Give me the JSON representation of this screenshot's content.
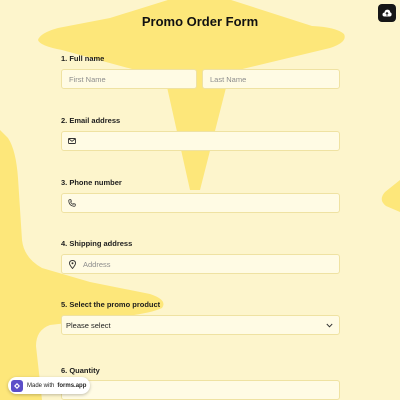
{
  "form": {
    "title": "Promo Order Form",
    "questions": [
      {
        "number_label": "1. Full name",
        "first_name_placeholder": "First Name",
        "last_name_placeholder": "Last Name"
      },
      {
        "number_label": "2. Email address",
        "icon": "envelope-icon",
        "value": ""
      },
      {
        "number_label": "3. Phone number",
        "icon": "phone-icon",
        "value": ""
      },
      {
        "number_label": "4. Shipping address",
        "icon": "location-pin-icon",
        "placeholder": "Address"
      },
      {
        "number_label": "5. Select the promo product",
        "selected": "Please select",
        "icon": "chevron-down-icon"
      },
      {
        "number_label": "6. Quantity",
        "value": ""
      }
    ]
  },
  "badge": {
    "prefix": "Made with",
    "brand": "forms.app"
  },
  "colors": {
    "background": "#fdf5cc",
    "shape": "#fde77a",
    "field_bg": "#fffbe4",
    "field_border": "#efe2a2",
    "brand_logo": "#5b4ec9"
  },
  "icons": {
    "top_right": "cloud-upload-icon"
  }
}
